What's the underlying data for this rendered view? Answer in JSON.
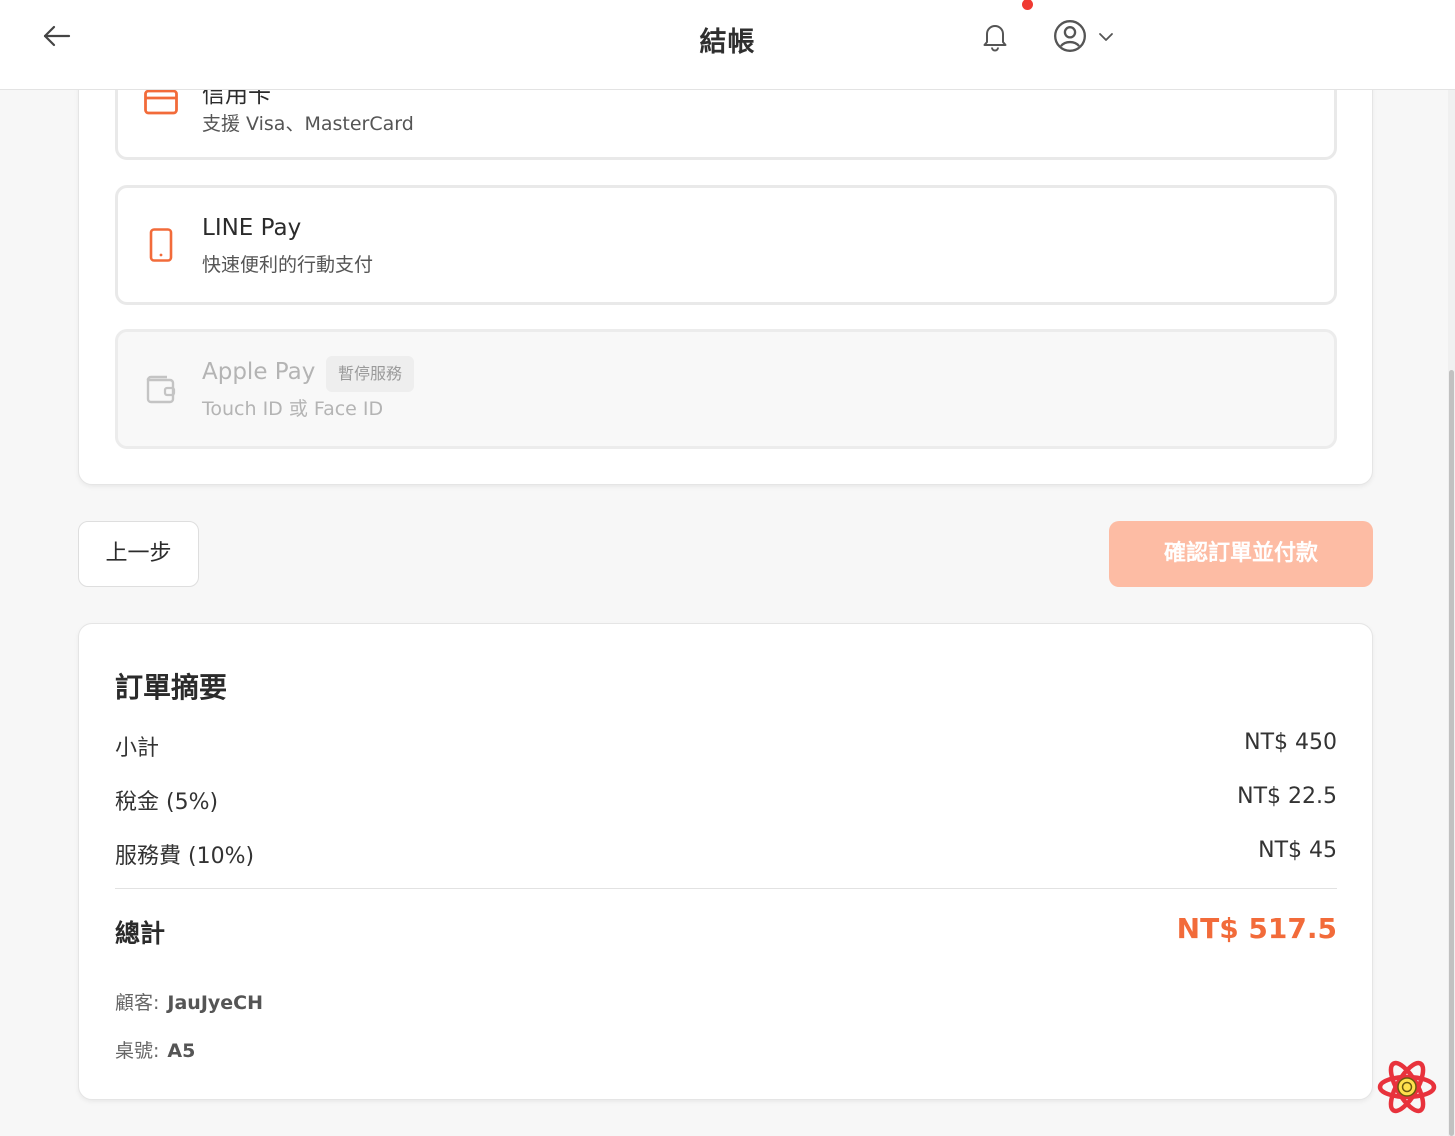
{
  "header": {
    "title": "結帳"
  },
  "payment_methods": [
    {
      "title": "信用卡",
      "description": "支援 Visa、MasterCard",
      "icon": "credit-card-icon",
      "disabled": false
    },
    {
      "title": "LINE Pay",
      "description": "快速便利的行動支付",
      "icon": "mobile-phone-icon",
      "disabled": false
    },
    {
      "title": "Apple Pay",
      "description": "Touch ID 或 Face ID",
      "icon": "wallet-icon",
      "badge": "暫停服務",
      "disabled": true
    }
  ],
  "actions": {
    "prev_label": "上一步",
    "confirm_label": "確認訂單並付款"
  },
  "summary": {
    "title": "訂單摘要",
    "rows": [
      {
        "label": "小計",
        "value": "NT$ 450"
      },
      {
        "label": "稅金 (5%)",
        "value": "NT$ 22.5"
      },
      {
        "label": "服務費 (10%)",
        "value": "NT$ 45"
      }
    ],
    "total": {
      "label": "總計",
      "value": "NT$ 517.5"
    },
    "customer": {
      "label": "顧客:",
      "value": "JauJyeCH"
    },
    "table": {
      "label": "桌號:",
      "value": "A5"
    }
  },
  "colors": {
    "accent": "#f26b3a",
    "confirm_button_disabled": "#fdbca4",
    "notification_dot": "#f03a32"
  }
}
